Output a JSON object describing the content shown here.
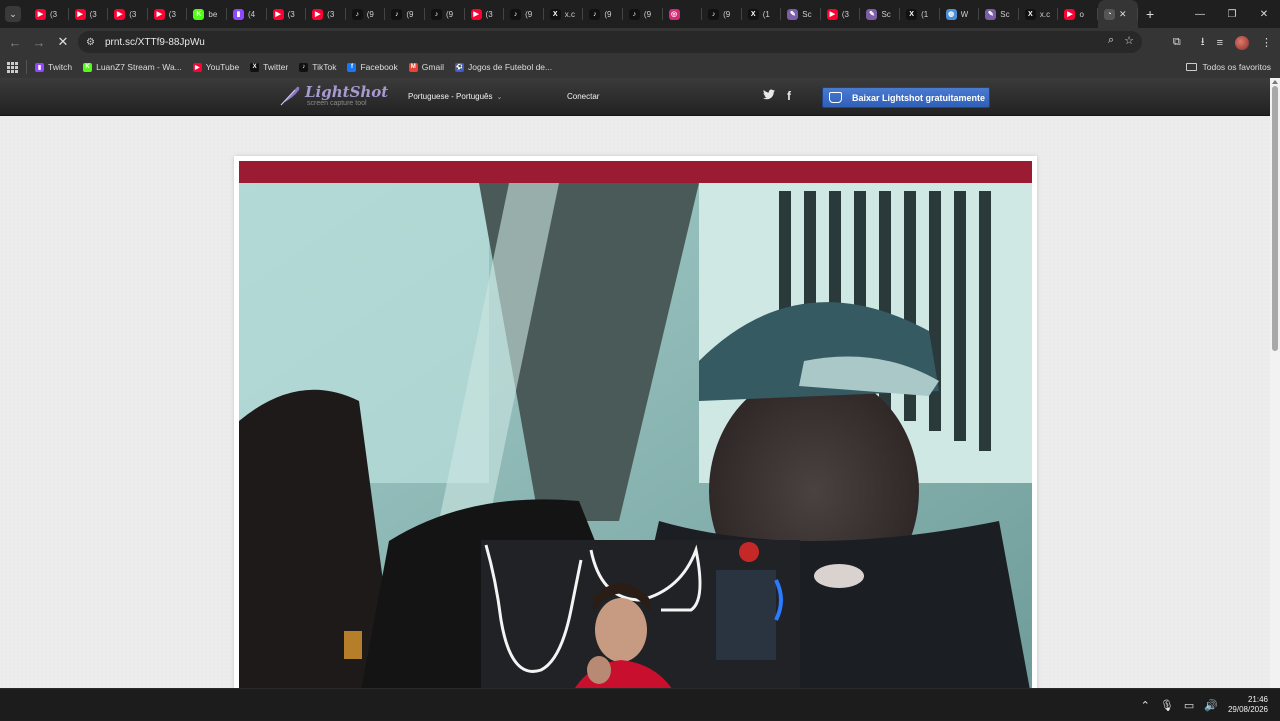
{
  "browser": {
    "tabs": [
      {
        "title": "(3",
        "icon": "youtube-icon",
        "color": "#ff0033"
      },
      {
        "title": "(3",
        "icon": "youtube-icon",
        "color": "#ff0033"
      },
      {
        "title": "(3",
        "icon": "youtube-icon",
        "color": "#ff0033"
      },
      {
        "title": "(3",
        "icon": "youtube-icon",
        "color": "#ff0033"
      },
      {
        "title": "be",
        "icon": "kick-icon",
        "color": "#53fc18"
      },
      {
        "title": "(4",
        "icon": "twitch-icon",
        "color": "#9146ff"
      },
      {
        "title": "(3",
        "icon": "youtube-icon",
        "color": "#ff0033"
      },
      {
        "title": "(3",
        "icon": "youtube-icon",
        "color": "#ff0033"
      },
      {
        "title": "(9",
        "icon": "tiktok-icon",
        "color": "#111111"
      },
      {
        "title": "(9",
        "icon": "tiktok-icon",
        "color": "#111111"
      },
      {
        "title": "(9",
        "icon": "tiktok-icon",
        "color": "#111111"
      },
      {
        "title": "(3",
        "icon": "youtube-icon",
        "color": "#ff0033"
      },
      {
        "title": "(9",
        "icon": "tiktok-icon",
        "color": "#111111"
      },
      {
        "title": "x.c",
        "icon": "x-icon",
        "color": "#111111"
      },
      {
        "title": "(9",
        "icon": "tiktok-icon",
        "color": "#111111"
      },
      {
        "title": "(9",
        "icon": "tiktok-icon",
        "color": "#111111"
      },
      {
        "title": "",
        "icon": "instagram-icon",
        "color": "#d62976"
      },
      {
        "title": "(9",
        "icon": "tiktok-icon",
        "color": "#111111"
      },
      {
        "title": "(1",
        "icon": "x-icon",
        "color": "#111111"
      },
      {
        "title": "Sc",
        "icon": "lightshot-icon",
        "color": "#7b5ea7"
      },
      {
        "title": "(3",
        "icon": "youtube-icon",
        "color": "#ff0033"
      },
      {
        "title": "Sc",
        "icon": "lightshot-icon",
        "color": "#7b5ea7"
      },
      {
        "title": "(1",
        "icon": "x-icon",
        "color": "#111111"
      },
      {
        "title": "W",
        "icon": "globe-icon",
        "color": "#4a90d9"
      },
      {
        "title": "Sc",
        "icon": "lightshot-icon",
        "color": "#7b5ea7"
      },
      {
        "title": "x.c",
        "icon": "x-icon",
        "color": "#111111"
      },
      {
        "title": "o",
        "icon": "youtube-icon",
        "color": "#ff0033"
      }
    ],
    "active_tab_close": "✕",
    "new_tab": "+",
    "window_controls": {
      "minimize": "—",
      "restore": "❐",
      "close": "✕"
    },
    "url": "prnt.sc/XTTf9-88JpWu",
    "bookmarks": [
      {
        "label": "Twitch",
        "icon": "twitch-icon",
        "color": "#9146ff"
      },
      {
        "label": "LuanZ7 Stream - Wa...",
        "icon": "kick-icon",
        "color": "#53fc18"
      },
      {
        "label": "YouTube",
        "icon": "youtube-icon",
        "color": "#ff0033"
      },
      {
        "label": "Twitter",
        "icon": "x-icon",
        "color": "#111111"
      },
      {
        "label": "TikTok",
        "icon": "tiktok-icon",
        "color": "#111111"
      },
      {
        "label": "Facebook",
        "icon": "facebook-icon",
        "color": "#1877f2"
      },
      {
        "label": "Gmail",
        "icon": "gmail-icon",
        "color": "#ea4335"
      },
      {
        "label": "Jogos de Futebol de...",
        "icon": "game-icon",
        "color": "#3b5bdb"
      }
    ],
    "bookmarks_folder": "Todos os favoritos"
  },
  "lightshot": {
    "brand": "LightShot",
    "tagline": "screen capture tool",
    "language": "Portuguese - Português",
    "login": "Conectar",
    "download_button": "Baixar Lightshot gratuitamente",
    "brand_color": "#a69ad0",
    "button_color": "#3a6cc4"
  },
  "taskbar": {
    "time": "21:46",
    "date": "29/08/2026"
  }
}
